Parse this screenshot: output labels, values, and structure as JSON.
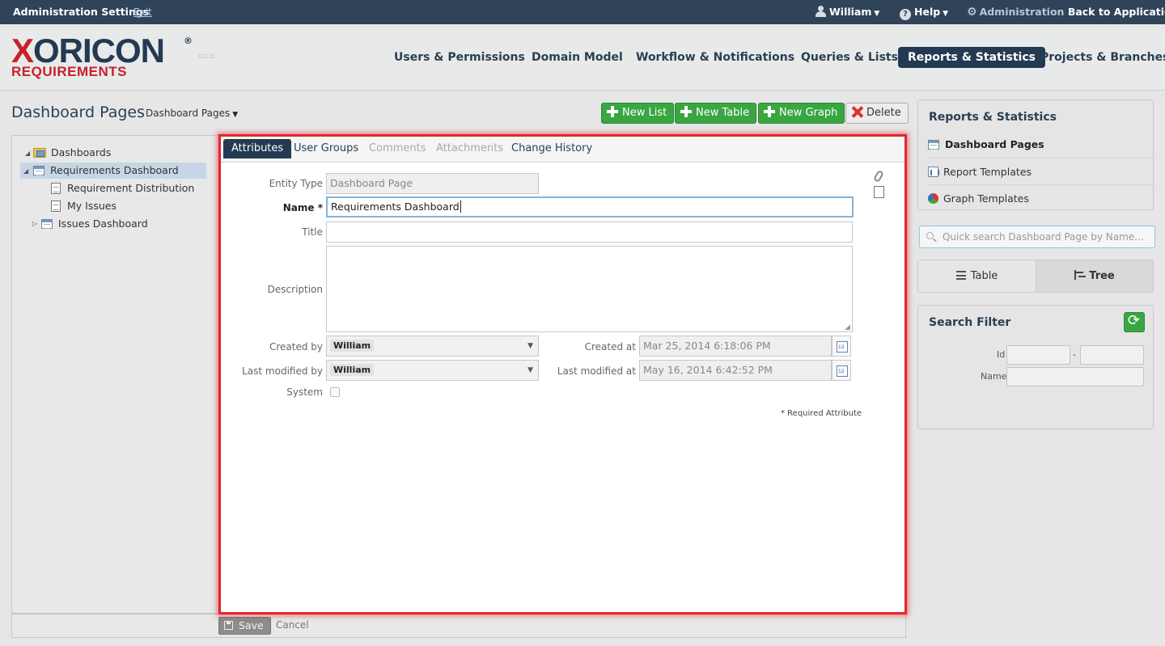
{
  "topbar": {
    "admin_title": "Administration Settings",
    "exit_label": "Exit",
    "user_label": "William",
    "help_label": "Help",
    "admin_label": "Administration",
    "back_label": "Back to Application"
  },
  "logo": {
    "main_x": "X",
    "main_rest": "ORICON",
    "reg": "®",
    "sub": "REQUIREMENTS"
  },
  "nav": {
    "items": [
      "Users & Permissions",
      "Domain Model",
      "Workflow & Notifications",
      "Queries & Lists",
      "Reports & Statistics",
      "Projects & Branches"
    ],
    "active": "Reports & Statistics"
  },
  "page": {
    "title": "Dashboard Pages",
    "dropdown": "Dashboard Pages"
  },
  "actions": {
    "new_list": "New List",
    "new_table": "New Table",
    "new_graph": "New Graph",
    "delete": "Delete"
  },
  "tree": {
    "root": "Dashboards",
    "items": [
      "Requirements Dashboard",
      "Requirement Distribution",
      "My Issues",
      "Issues Dashboard"
    ]
  },
  "tabs": [
    "Attributes",
    "User Groups",
    "Comments",
    "Attachments",
    "Change History"
  ],
  "form": {
    "entity_type_label": "Entity Type",
    "entity_type_value": "Dashboard Page",
    "name_label": "Name",
    "name_required": "*",
    "name_value": "Requirements Dashboard",
    "title_label": "Title",
    "title_value": "",
    "description_label": "Description",
    "description_value": "",
    "created_by_label": "Created by",
    "created_by_value": "William",
    "created_at_label": "Created at",
    "created_at_value": "Mar 25, 2014 6:18:06 PM",
    "modified_by_label": "Last modified by",
    "modified_by_value": "William",
    "modified_at_label": "Last modified at",
    "modified_at_value": "May 16, 2014 6:42:52 PM",
    "system_label": "System",
    "system_checked": false,
    "required_note": "* Required Attribute"
  },
  "footer": {
    "save": "Save",
    "cancel": "Cancel"
  },
  "sidebar": {
    "title": "Reports & Statistics",
    "items": [
      "Dashboard Pages",
      "Report Templates",
      "Graph Templates"
    ],
    "active": "Dashboard Pages",
    "search_placeholder": "Quick search Dashboard Page by Name...",
    "view_table": "Table",
    "view_tree": "Tree",
    "filter_title": "Search Filter",
    "filter_id_label": "Id",
    "filter_dash": "-",
    "filter_name_label": "Name"
  },
  "colors": {
    "topbar": "#2f4459",
    "nav_active": "#233a52",
    "accent_green": "#3aa642",
    "highlight_red": "#e1262f",
    "logo_red": "#c8202a"
  }
}
